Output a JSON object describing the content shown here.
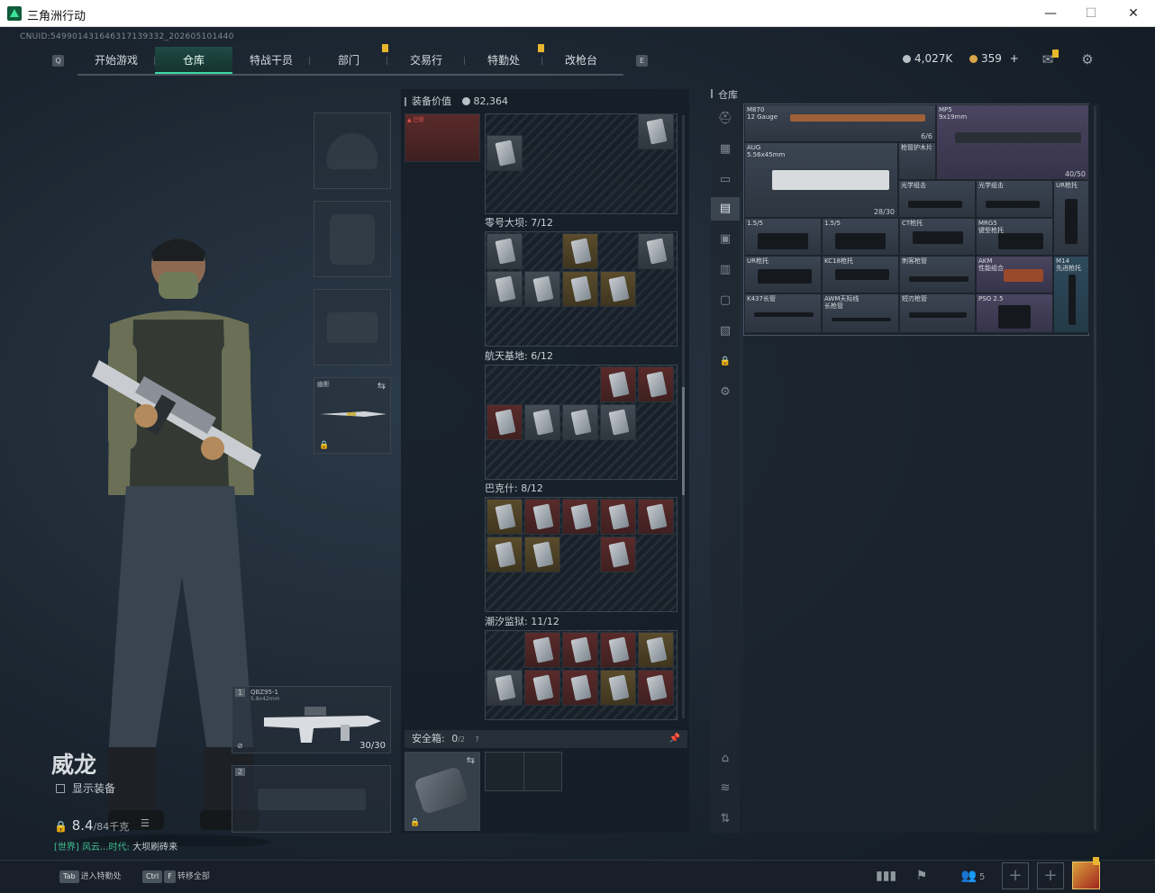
{
  "window": {
    "title": "三角洲行动",
    "minimize": "—",
    "maximize": "☐",
    "close": "✕"
  },
  "uid": "CNUID:549901431646317139332_202605101440",
  "nav": {
    "left_key": "Q",
    "right_key": "E",
    "tabs": [
      {
        "label": "开始游戏",
        "active": false
      },
      {
        "label": "仓库",
        "active": true
      },
      {
        "label": "特战干员",
        "active": false
      },
      {
        "label": "部门",
        "active": false,
        "badge": true
      },
      {
        "label": "交易行",
        "active": false
      },
      {
        "label": "特勤处",
        "active": false,
        "badge": true
      },
      {
        "label": "改枪台",
        "active": false
      }
    ]
  },
  "currency": {
    "silver": "4,027K",
    "gold": "359",
    "plus": "+",
    "silver_color": "#b9c0c6",
    "gold_color": "#d9a64a"
  },
  "operator": {
    "name": "威龙",
    "show_equipment": "显示装备",
    "weight_value": "8.4",
    "weight_max": "/84千克"
  },
  "chat": {
    "channel": "[世界] 风云...时代:",
    "message": "大坝刷砖来"
  },
  "equipment": {
    "melee_label": "幽影",
    "primary": {
      "index": "1",
      "name": "QBZ95-1",
      "caliber": "5.8x42mm",
      "ammo": "30/30"
    },
    "secondary_index": "2"
  },
  "backpack": {
    "value_label": "装备价值",
    "value": "82,364",
    "maps": [
      {
        "label": "零号大坝: 7/12"
      },
      {
        "label": "航天基地: 6/12"
      },
      {
        "label": "巴克什: 8/12"
      },
      {
        "label": "潮汐监狱: 11/12"
      }
    ],
    "safe_box": {
      "label": "安全箱:",
      "count": "0",
      "cap": "/2",
      "help": "?"
    }
  },
  "warehouse": {
    "title": "仓库",
    "items": [
      {
        "name": "M870\n12 Gauge",
        "count": "6/6"
      },
      {
        "name": "MP5\n9x19mm",
        "count": "40/50"
      },
      {
        "name": "AUG\n5.56x45mm",
        "count": "28/30"
      },
      {
        "name": "枪管护木片",
        "count": ""
      },
      {
        "name": "光学组击",
        "count": ""
      },
      {
        "name": "光学组击",
        "count": ""
      },
      {
        "name": "UR枪托",
        "count": ""
      },
      {
        "name": "1.5/5",
        "count": ""
      },
      {
        "name": "1.5/5",
        "count": ""
      },
      {
        "name": "CT枪托",
        "count": ""
      },
      {
        "name": "MRG5\n键型枪托",
        "count": ""
      },
      {
        "name": "UR枪托",
        "count": ""
      },
      {
        "name": "KC18枪托",
        "count": ""
      },
      {
        "name": "刺客枪管",
        "count": ""
      },
      {
        "name": "AKM\n性能组合",
        "count": ""
      },
      {
        "name": "M14\n先进枪托",
        "count": ""
      },
      {
        "name": "K437长管",
        "count": ""
      },
      {
        "name": "AWM天际线\n长枪管",
        "count": ""
      },
      {
        "name": "短刃枪管",
        "count": ""
      },
      {
        "name": "PSO 2.5",
        "count": ""
      }
    ]
  },
  "bottom": {
    "hint1_key": "Tab",
    "hint1_text": "进入特勤处",
    "hint2_key1": "Ctrl",
    "hint2_key2": "F",
    "hint2_text": "转移全部",
    "squad_count": "5"
  }
}
